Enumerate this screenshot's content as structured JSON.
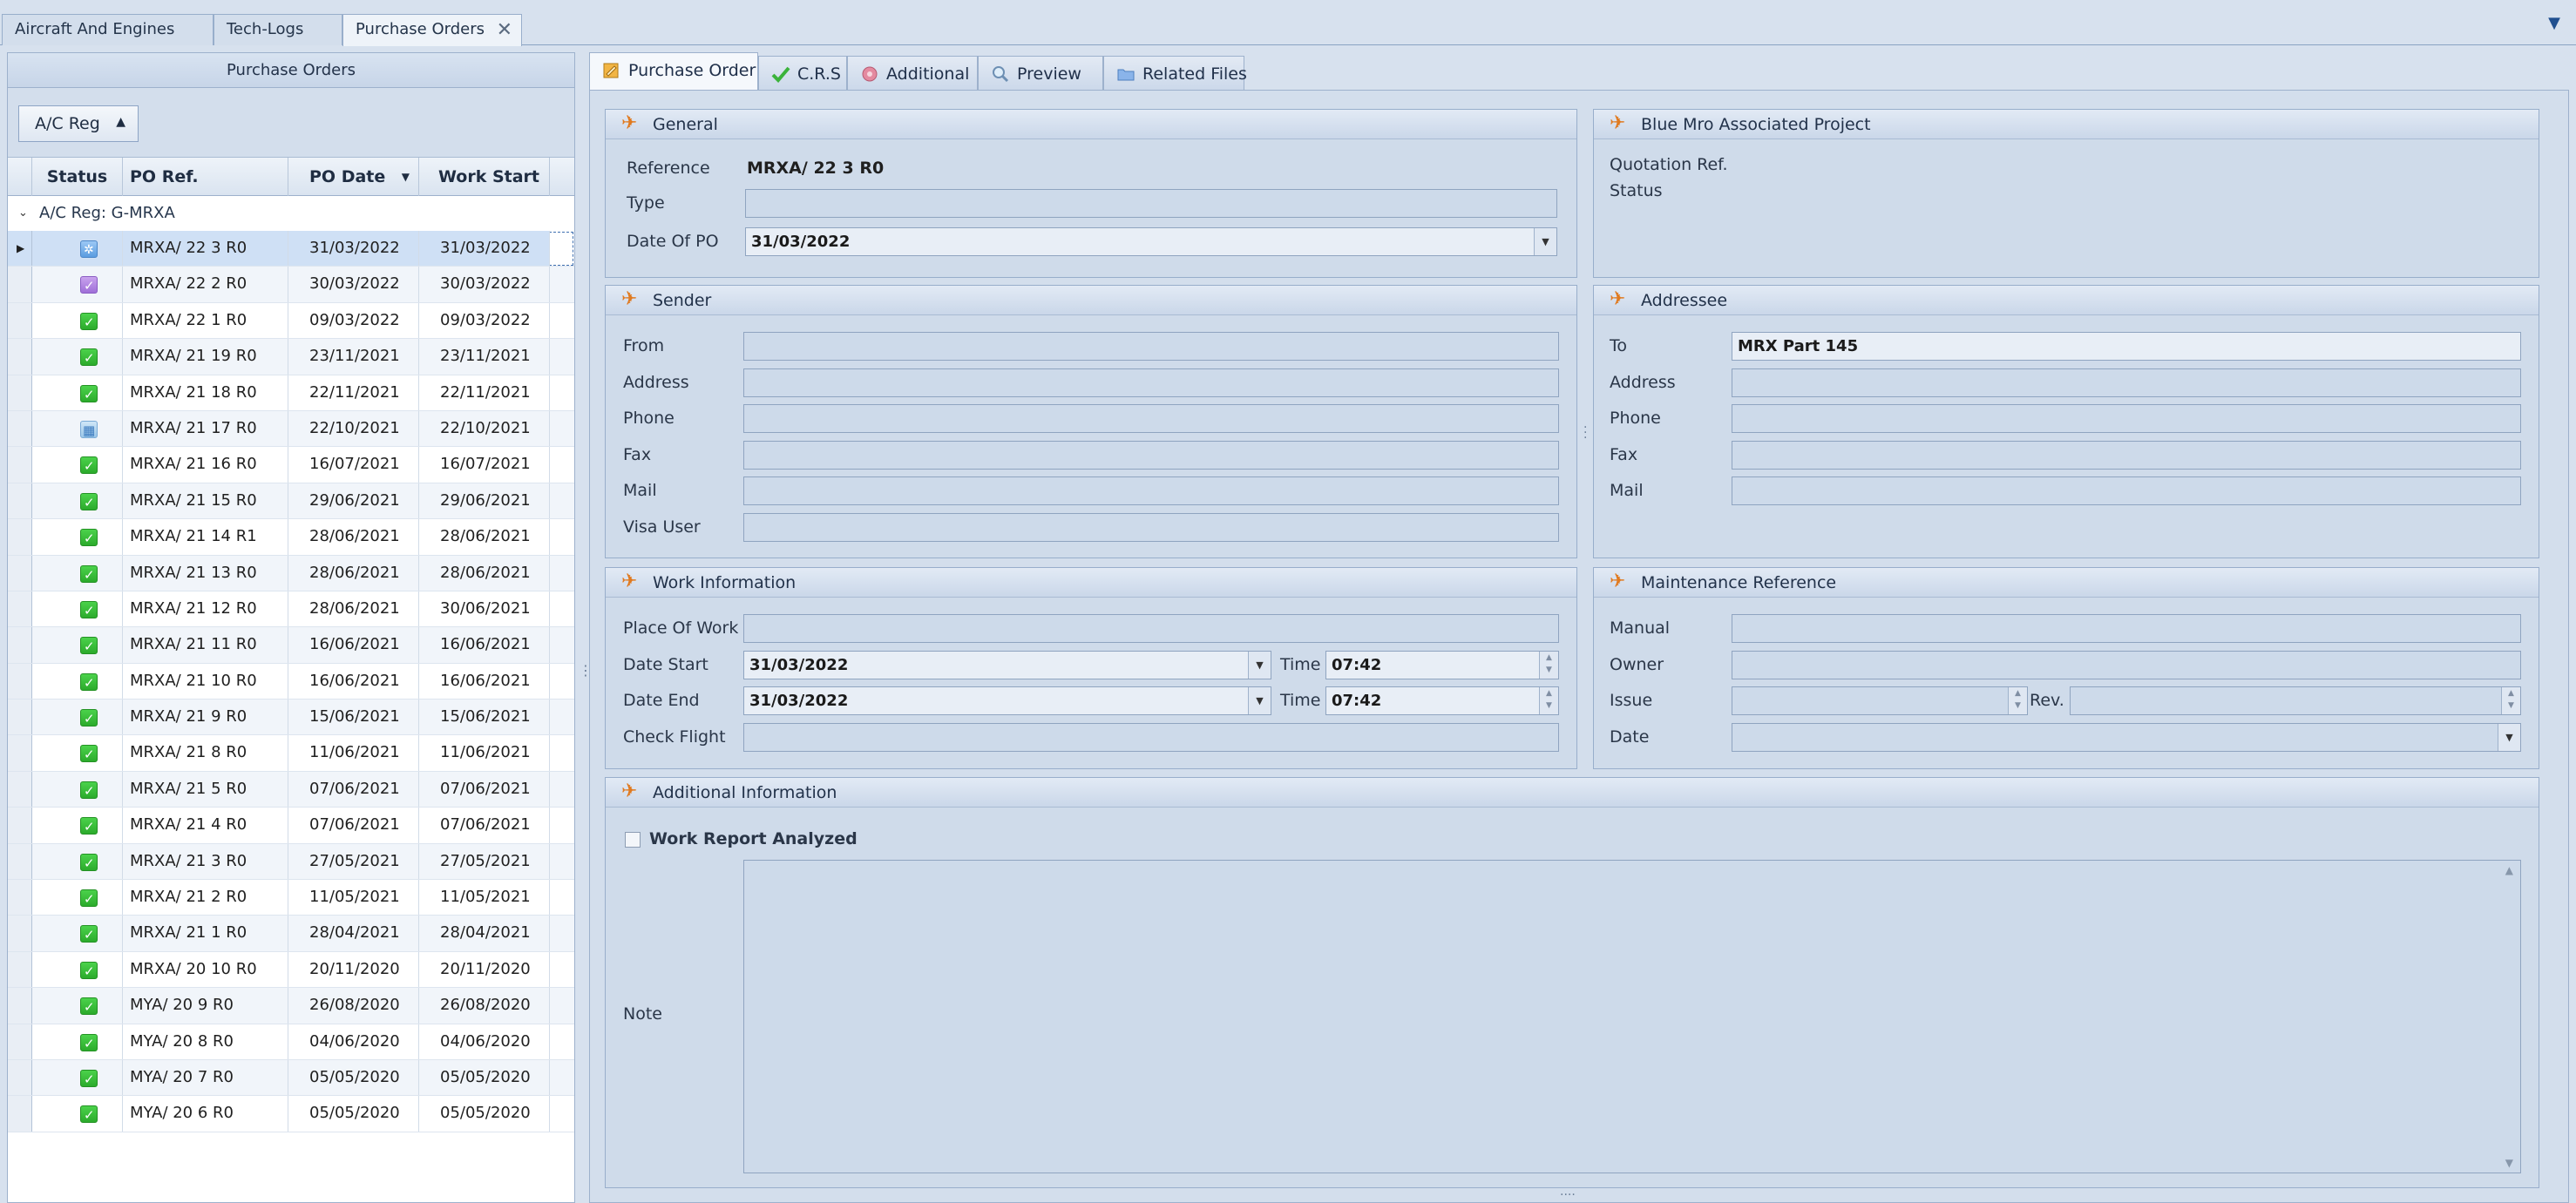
{
  "doc_tabs": [
    {
      "label": "Aircraft And Engines"
    },
    {
      "label": "Tech-Logs"
    },
    {
      "label": "Purchase Orders"
    }
  ],
  "left": {
    "title": "Purchase Orders",
    "group_button": "A/C Reg",
    "columns": {
      "status": "Status",
      "ref": "PO Ref.",
      "date": "PO Date",
      "start": "Work Start"
    },
    "group_label": "A/C Reg: G-MRXA",
    "rows": [
      {
        "status": "gear",
        "ref": "MRXA/ 22 3 R0",
        "date": "31/03/2022",
        "start": "31/03/2022"
      },
      {
        "status": "purple",
        "ref": "MRXA/ 22 2 R0",
        "date": "30/03/2022",
        "start": "30/03/2022"
      },
      {
        "status": "check",
        "ref": "MRXA/ 22 1 R0",
        "date": "09/03/2022",
        "start": "09/03/2022"
      },
      {
        "status": "check",
        "ref": "MRXA/ 21 19 R0",
        "date": "23/11/2021",
        "start": "23/11/2021"
      },
      {
        "status": "check",
        "ref": "MRXA/ 21 18 R0",
        "date": "22/11/2021",
        "start": "22/11/2021"
      },
      {
        "status": "table",
        "ref": "MRXA/ 21 17 R0",
        "date": "22/10/2021",
        "start": "22/10/2021"
      },
      {
        "status": "check",
        "ref": "MRXA/ 21 16 R0",
        "date": "16/07/2021",
        "start": "16/07/2021"
      },
      {
        "status": "check",
        "ref": "MRXA/ 21 15 R0",
        "date": "29/06/2021",
        "start": "29/06/2021"
      },
      {
        "status": "check",
        "ref": "MRXA/ 21 14 R1",
        "date": "28/06/2021",
        "start": "28/06/2021"
      },
      {
        "status": "check",
        "ref": "MRXA/ 21 13 R0",
        "date": "28/06/2021",
        "start": "28/06/2021"
      },
      {
        "status": "check",
        "ref": "MRXA/ 21 12 R0",
        "date": "28/06/2021",
        "start": "30/06/2021"
      },
      {
        "status": "check",
        "ref": "MRXA/ 21 11 R0",
        "date": "16/06/2021",
        "start": "16/06/2021"
      },
      {
        "status": "check",
        "ref": "MRXA/ 21 10 R0",
        "date": "16/06/2021",
        "start": "16/06/2021"
      },
      {
        "status": "check",
        "ref": "MRXA/ 21 9 R0",
        "date": "15/06/2021",
        "start": "15/06/2021"
      },
      {
        "status": "check",
        "ref": "MRXA/ 21 8 R0",
        "date": "11/06/2021",
        "start": "11/06/2021"
      },
      {
        "status": "check",
        "ref": "MRXA/ 21 5 R0",
        "date": "07/06/2021",
        "start": "07/06/2021"
      },
      {
        "status": "check",
        "ref": "MRXA/ 21 4 R0",
        "date": "07/06/2021",
        "start": "07/06/2021"
      },
      {
        "status": "check",
        "ref": "MRXA/ 21 3 R0",
        "date": "27/05/2021",
        "start": "27/05/2021"
      },
      {
        "status": "check",
        "ref": "MRXA/ 21 2 R0",
        "date": "11/05/2021",
        "start": "11/05/2021"
      },
      {
        "status": "check",
        "ref": "MRXA/ 21 1 R0",
        "date": "28/04/2021",
        "start": "28/04/2021"
      },
      {
        "status": "check",
        "ref": "MRXA/ 20 10 R0",
        "date": "20/11/2020",
        "start": "20/11/2020"
      },
      {
        "status": "check",
        "ref": "MYA/ 20 9 R0",
        "date": "26/08/2020",
        "start": "26/08/2020"
      },
      {
        "status": "check",
        "ref": "MYA/ 20 8 R0",
        "date": "04/06/2020",
        "start": "04/06/2020"
      },
      {
        "status": "check",
        "ref": "MYA/ 20 7 R0",
        "date": "05/05/2020",
        "start": "05/05/2020"
      },
      {
        "status": "check",
        "ref": "MYA/ 20 6 R0",
        "date": "05/05/2020",
        "start": "05/05/2020"
      }
    ]
  },
  "right_tabs": [
    {
      "label": "Purchase Order",
      "icon": "pencil-icon"
    },
    {
      "label": "C.R.S",
      "icon": "check-icon"
    },
    {
      "label": "Additional",
      "icon": "disk-icon"
    },
    {
      "label": "Preview",
      "icon": "magnifier-icon"
    },
    {
      "label": "Related Files",
      "icon": "folder-icon"
    }
  ],
  "general": {
    "title": "General",
    "reference_label": "Reference",
    "reference_value": "MRXA/ 22 3 R0",
    "type_label": "Type",
    "type_value": "",
    "date_label": "Date Of PO",
    "date_value": "31/03/2022"
  },
  "project": {
    "title": "Blue Mro Associated Project",
    "quotation_label": "Quotation Ref.",
    "status_label": "Status"
  },
  "sender": {
    "title": "Sender",
    "from_label": "From",
    "address_label": "Address",
    "phone_label": "Phone",
    "fax_label": "Fax",
    "mail_label": "Mail",
    "visa_label": "Visa User"
  },
  "addressee": {
    "title": "Addressee",
    "to_label": "To",
    "to_value": "MRX Part 145",
    "address_label": "Address",
    "phone_label": "Phone",
    "fax_label": "Fax",
    "mail_label": "Mail"
  },
  "work": {
    "title": "Work Information",
    "place_label": "Place Of Work",
    "start_label": "Date Start",
    "start_value": "31/03/2022",
    "end_label": "Date End",
    "end_value": "31/03/2022",
    "time_label": "Time",
    "start_time": "07:42",
    "end_time": "07:42",
    "check_label": "Check Flight"
  },
  "maint": {
    "title": "Maintenance Reference",
    "manual_label": "Manual",
    "owner_label": "Owner",
    "issue_label": "Issue",
    "rev_label": "Rev.",
    "date_label": "Date"
  },
  "additional": {
    "title": "Additional Information",
    "analyzed_label": "Work Report Analyzed",
    "note_label": "Note"
  }
}
